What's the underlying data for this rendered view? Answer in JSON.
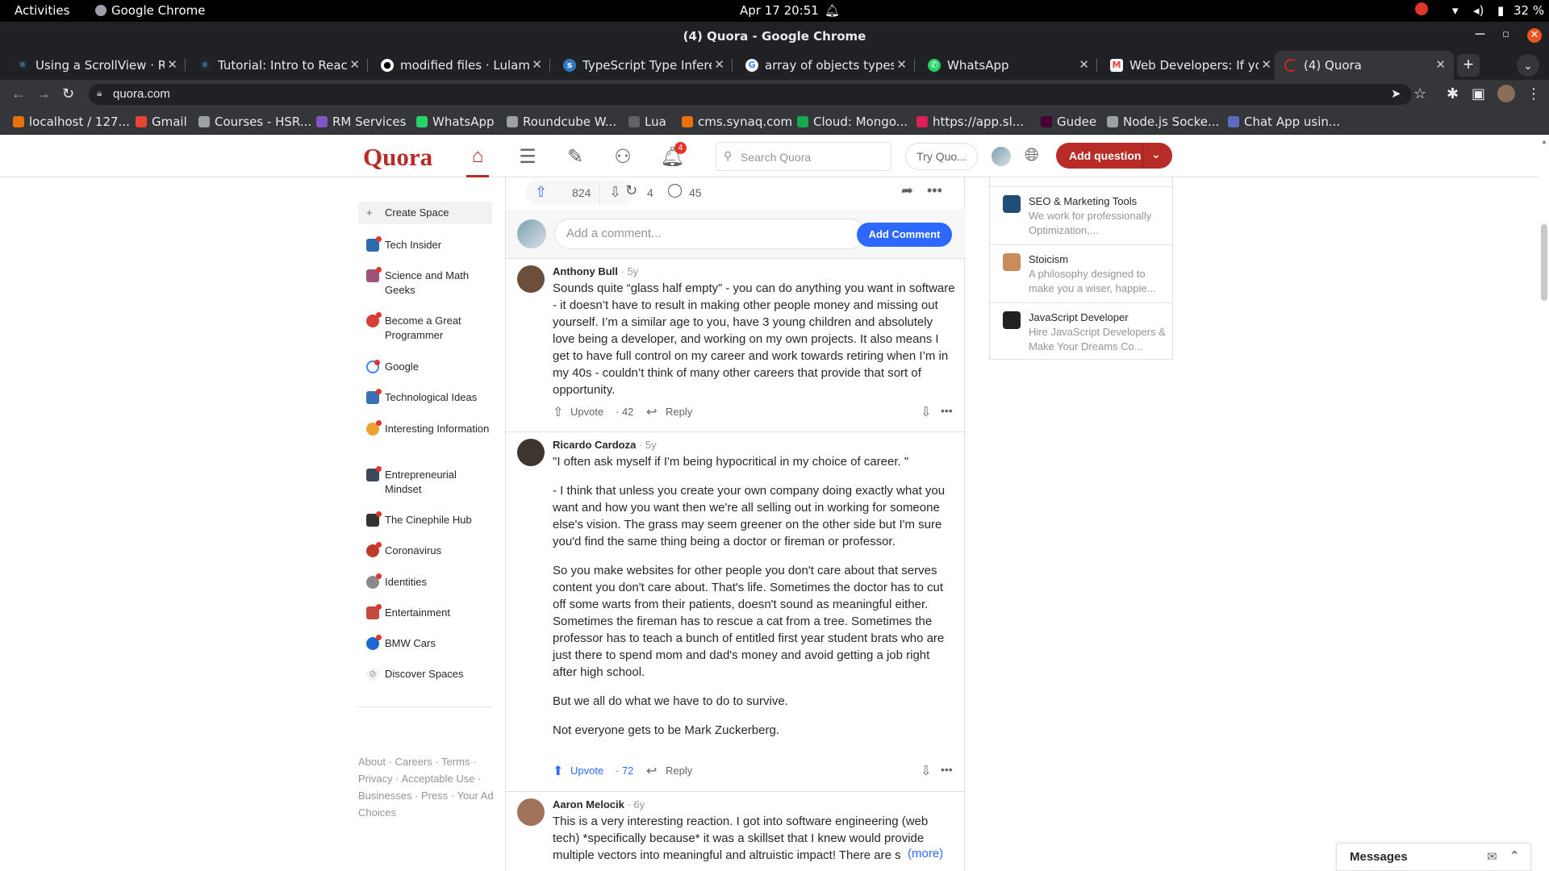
{
  "system": {
    "activities": "Activities",
    "app": "Google Chrome",
    "datetime": "Apr 17  20:51",
    "battery": "32 %"
  },
  "window": {
    "title": "(4) Quora - Google Chrome"
  },
  "tabs": [
    {
      "label": "Using a ScrollView · Rea",
      "color": "#61dafb"
    },
    {
      "label": "Tutorial: Intro to React",
      "color": "#61dafb"
    },
    {
      "label": "modified files · Lulamile",
      "color": "#ffffff"
    },
    {
      "label": "TypeScript Type Inferen",
      "color": "#3178c6"
    },
    {
      "label": "array of objects typesc",
      "color": "#4285f4"
    },
    {
      "label": "WhatsApp",
      "color": "#25d366"
    },
    {
      "label": "Web Developers: If you",
      "color": "#ea4335"
    },
    {
      "label": "(4) Quora",
      "color": "#b92b27"
    }
  ],
  "address": {
    "url": "quora.com"
  },
  "bookmarks": [
    {
      "label": "localhost / 127...",
      "color": "#e8710a"
    },
    {
      "label": "Gmail",
      "color": "#ea4335"
    },
    {
      "label": "Courses - HSR...",
      "color": "#9aa0a6"
    },
    {
      "label": "RM Services",
      "color": "#7e57c2"
    },
    {
      "label": "WhatsApp",
      "color": "#25d366"
    },
    {
      "label": "Roundcube W...",
      "color": "#9aa0a6"
    },
    {
      "label": "Lua",
      "color": "#5f6368"
    },
    {
      "label": "cms.synaq.com",
      "color": "#e8710a"
    },
    {
      "label": "Cloud: Mongo...",
      "color": "#13aa52"
    },
    {
      "label": "https://app.sl...",
      "color": "#e01e5a"
    },
    {
      "label": "Gudee",
      "color": "#470137"
    },
    {
      "label": "Node.js Socke...",
      "color": "#9aa0a6"
    },
    {
      "label": "Chat App usin...",
      "color": "#5c6bc0"
    }
  ],
  "quora": {
    "logo": "Quora",
    "notif_count": "4",
    "search_placeholder": "Search Quora",
    "try": "Try Quo...",
    "add_question": "Add question"
  },
  "sidebar": {
    "items": [
      {
        "label": "Create Space",
        "color": "#f1f2f2"
      },
      {
        "label": "Tech Insider",
        "color": "#2b6cb0"
      },
      {
        "label": "Science and Math Geeks",
        "color": "#a0527a"
      },
      {
        "label": "Become a Great Programmer",
        "color": "#d43f3a"
      },
      {
        "label": "Google",
        "color": "#4285f4"
      },
      {
        "label": "Technological Ideas",
        "color": "#3b6fb6"
      },
      {
        "label": "Interesting Information",
        "color": "#f0a030"
      },
      {
        "label": "Entrepreneurial Mindset",
        "color": "#3a4a5c"
      },
      {
        "label": "The Cinephile Hub",
        "color": "#333333"
      },
      {
        "label": "Coronavirus",
        "color": "#c0392b"
      },
      {
        "label": "Identities",
        "color": "#8a8a8a"
      },
      {
        "label": "Entertainment",
        "color": "#c44b3e"
      },
      {
        "label": "BMW Cars",
        "color": "#1c69d4"
      },
      {
        "label": "Discover Spaces",
        "color": "#f1f2f2"
      }
    ],
    "footer": [
      "About · Careers · Terms ·",
      "Privacy · Acceptable Use ·",
      "Businesses · Press · Your Ad",
      "Choices"
    ]
  },
  "answer_actions": {
    "upvotes": "824",
    "shares": "4",
    "comments": "45"
  },
  "comment_box": {
    "placeholder": "Add a comment...",
    "button": "Add Comment"
  },
  "comments": [
    {
      "name": "Anthony Bull",
      "age": " · 5y",
      "paragraphs": [
        "Sounds quite “glass half empty” - you can do anything you want in software - it doesn’t have to result in making other people money and missing out yourself. I’m a similar age to you, have 3 young children and absolutely love being a developer, and working on my own projects. It also means I get to have full control on my career and work towards retiring when I’m in my 40s - couldn’t think of many other careers that provide that sort of opportunity."
      ],
      "upvote": "Upvote",
      "upvotes": "· 42",
      "reply": "Reply"
    },
    {
      "name": "Ricardo Cardoza",
      "age": " · 5y",
      "paragraphs": [
        "\"I often ask myself if I'm being hypocritical in my choice of career. \"",
        "- I think that unless you create your own company doing exactly what you want and how you want then we're all selling out in working for someone else's vision. The grass may seem greener on the other side but I'm sure you'd find the same thing being a doctor or fireman or professor.",
        "So you make websites for other people you don't care about that serves content you don't care about. That's life. Sometimes the doctor has to cut off some warts from their patients, doesn't sound as meaningful either. Sometimes the fireman has to rescue a cat from a tree. Sometimes the professor has to teach a bunch of entitled first year student brats who are just there to spend mom and dad's money and avoid getting a job right after high school.",
        "But we all do what we have to do to survive.",
        "Not everyone gets to be Mark Zuckerberg."
      ],
      "upvote": "Upvote",
      "upvotes": "· 72",
      "reply": "Reply"
    },
    {
      "name": "Aaron Melocik",
      "age": " · 6y",
      "paragraphs": [
        "This is a very interesting reaction. I got into software engineering (web tech) *specifically because* it was a skillset that I knew would provide multiple vectors into meaningful and altruistic impact! There are s"
      ],
      "more": "(more)"
    }
  ],
  "right_spaces": [
    {
      "title": "SEO & Marketing Tools",
      "desc": "We work for professionally Optimization,...",
      "color": "#1f4e79"
    },
    {
      "title": "Stoicism",
      "desc": "A philosophy designed to make you a wiser, happie...",
      "color": "#c98b5a"
    },
    {
      "title": "JavaScript Developer",
      "desc": "Hire JavaScript Developers & Make Your Dreams Co...",
      "color": "#222222"
    }
  ],
  "messages": {
    "label": "Messages"
  }
}
